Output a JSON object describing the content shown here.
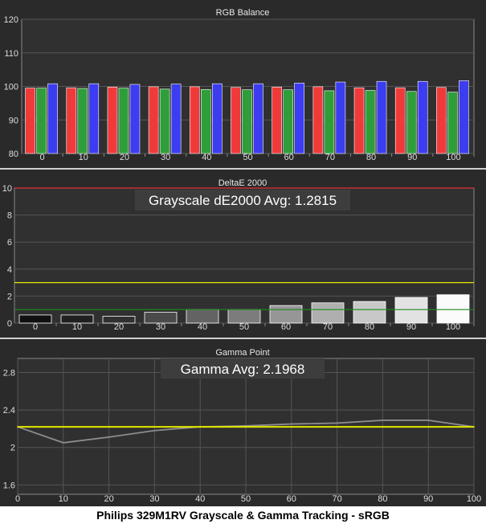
{
  "caption": "Philips 329M1RV Grayscale & Gamma Tracking - sRGB",
  "colors": {
    "background": "#2a2a2a",
    "plot_bg": "#303030",
    "grid": "#555555",
    "red": "#f03a3a",
    "green": "#2f9e3a",
    "blue": "#3c3cf0",
    "yellow": "#e6e600",
    "dark_green": "#1e8a1e",
    "max_line": "#e03030",
    "gamma_line": "#8c8c8c",
    "label_box": "#3d3d3d"
  },
  "chart_data": [
    {
      "type": "bar",
      "title": "RGB Balance",
      "categories": [
        "0",
        "10",
        "20",
        "30",
        "40",
        "50",
        "60",
        "70",
        "80",
        "90",
        "100"
      ],
      "series": [
        {
          "color": "red",
          "values": [
            99.5,
            99.6,
            99.8,
            99.9,
            99.9,
            99.7,
            99.8,
            99.9,
            99.6,
            99.6,
            99.7
          ]
        },
        {
          "color": "green",
          "values": [
            99.5,
            99.4,
            99.5,
            99.2,
            99.1,
            99.0,
            99.0,
            98.7,
            98.8,
            98.5,
            98.3
          ]
        },
        {
          "color": "blue",
          "values": [
            100.8,
            100.8,
            100.6,
            100.7,
            100.8,
            100.8,
            101.0,
            101.3,
            101.5,
            101.5,
            101.7
          ]
        }
      ],
      "ylim": [
        80,
        120
      ],
      "yticks": [
        80,
        90,
        100,
        110,
        120
      ],
      "grid": "horizontal"
    },
    {
      "type": "bar",
      "title": "DeltaE 2000",
      "annotation": "Grayscale dE2000 Avg: 1.2815",
      "categories": [
        "0",
        "10",
        "20",
        "30",
        "40",
        "50",
        "60",
        "70",
        "80",
        "90",
        "100"
      ],
      "values": [
        0.6,
        0.6,
        0.5,
        0.8,
        1.0,
        1.0,
        1.3,
        1.5,
        1.6,
        1.9,
        2.1
      ],
      "bar_grays": [
        "#101010",
        "#202020",
        "#303030",
        "#4a4a4a",
        "#636363",
        "#7c7c7c",
        "#969696",
        "#afafaf",
        "#c8c8c8",
        "#e2e2e2",
        "#fbfbfb"
      ],
      "reference_lines": [
        {
          "value": 3,
          "color": "yellow"
        },
        {
          "value": 1,
          "color": "dark_green"
        },
        {
          "value": 10,
          "color": "max_line"
        }
      ],
      "ylim": [
        0,
        10
      ],
      "yticks": [
        0,
        2,
        4,
        6,
        8,
        10
      ],
      "grid": "horizontal"
    },
    {
      "type": "line",
      "title": "Gamma Point",
      "annotation": "Gamma Avg: 2.1968",
      "x": [
        0,
        10,
        20,
        30,
        40,
        50,
        60,
        70,
        80,
        90,
        100
      ],
      "series": [
        {
          "color": "gamma_line",
          "values": [
            2.22,
            2.05,
            2.11,
            2.18,
            2.22,
            2.23,
            2.25,
            2.26,
            2.29,
            2.29,
            2.22
          ]
        },
        {
          "color": "yellow",
          "values": [
            2.22,
            2.22,
            2.22,
            2.22,
            2.22,
            2.22,
            2.22,
            2.22,
            2.22,
            2.22,
            2.22
          ]
        }
      ],
      "xlim": [
        0,
        100
      ],
      "ylim": [
        1.5,
        2.95
      ],
      "yticks": [
        1.6,
        2,
        2.4,
        2.8
      ],
      "ytick_labels": [
        "1.6",
        "2",
        "2.4",
        "2.8"
      ],
      "xticks": [
        0,
        10,
        20,
        30,
        40,
        50,
        60,
        70,
        80,
        90,
        100
      ],
      "grid": "both"
    }
  ]
}
